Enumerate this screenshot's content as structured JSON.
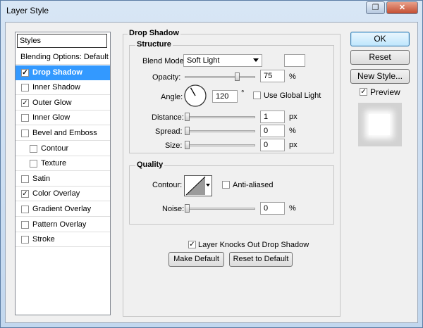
{
  "window": {
    "title": "Layer Style",
    "restore_label": "❐",
    "close_label": "✕"
  },
  "styles_list": {
    "header": "Styles",
    "items": [
      {
        "label": "Blending Options: Default",
        "checkbox": false,
        "checked": false,
        "selected": false,
        "indent": 0
      },
      {
        "label": "Drop Shadow",
        "checkbox": true,
        "checked": true,
        "selected": true,
        "indent": 0
      },
      {
        "label": "Inner Shadow",
        "checkbox": true,
        "checked": false,
        "selected": false,
        "indent": 0
      },
      {
        "label": "Outer Glow",
        "checkbox": true,
        "checked": true,
        "selected": false,
        "indent": 0
      },
      {
        "label": "Inner Glow",
        "checkbox": true,
        "checked": false,
        "selected": false,
        "indent": 0
      },
      {
        "label": "Bevel and Emboss",
        "checkbox": true,
        "checked": false,
        "selected": false,
        "indent": 0
      },
      {
        "label": "Contour",
        "checkbox": true,
        "checked": false,
        "selected": false,
        "indent": 1
      },
      {
        "label": "Texture",
        "checkbox": true,
        "checked": false,
        "selected": false,
        "indent": 1
      },
      {
        "label": "Satin",
        "checkbox": true,
        "checked": false,
        "selected": false,
        "indent": 0
      },
      {
        "label": "Color Overlay",
        "checkbox": true,
        "checked": true,
        "selected": false,
        "indent": 0
      },
      {
        "label": "Gradient Overlay",
        "checkbox": true,
        "checked": false,
        "selected": false,
        "indent": 0
      },
      {
        "label": "Pattern Overlay",
        "checkbox": true,
        "checked": false,
        "selected": false,
        "indent": 0
      },
      {
        "label": "Stroke",
        "checkbox": true,
        "checked": false,
        "selected": false,
        "indent": 0
      }
    ]
  },
  "drop_shadow": {
    "group_title": "Drop Shadow",
    "structure": {
      "title": "Structure",
      "blend_mode_label": "Blend Mode:",
      "blend_mode_value": "Soft Light",
      "shadow_color": "#ffffff",
      "opacity_label": "Opacity:",
      "opacity_value": "75",
      "opacity_unit": "%",
      "opacity_fraction": 0.75,
      "angle_label": "Angle:",
      "angle_value": "120",
      "angle_unit": "°",
      "angle_degrees": 120,
      "use_global_light_label": "Use Global Light",
      "use_global_light_checked": false,
      "distance_label": "Distance:",
      "distance_value": "1",
      "distance_unit": "px",
      "spread_label": "Spread:",
      "spread_value": "0",
      "spread_unit": "%",
      "size_label": "Size:",
      "size_value": "0",
      "size_unit": "px"
    },
    "quality": {
      "title": "Quality",
      "contour_label": "Contour:",
      "anti_aliased_label": "Anti-aliased",
      "anti_aliased_checked": false,
      "noise_label": "Noise:",
      "noise_value": "0",
      "noise_unit": "%"
    },
    "knocks_out_label": "Layer Knocks Out Drop Shadow",
    "knocks_out_checked": true,
    "make_default_label": "Make Default",
    "reset_default_label": "Reset to Default"
  },
  "actions": {
    "ok_label": "OK",
    "reset_label": "Reset",
    "new_style_label": "New Style...",
    "preview_label": "Preview",
    "preview_checked": true
  }
}
